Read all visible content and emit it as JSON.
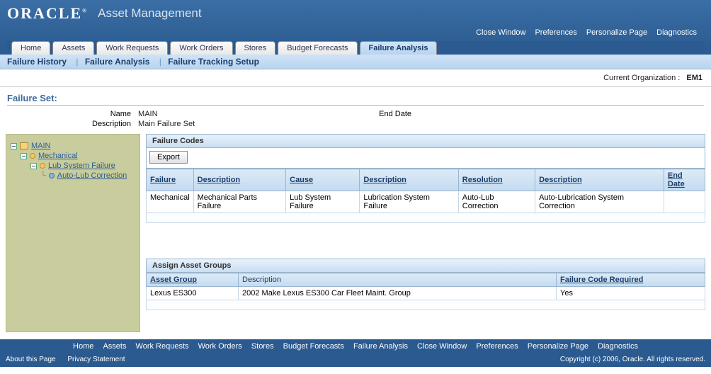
{
  "header": {
    "brand": "ORACLE",
    "app_title": "Asset Management",
    "links": [
      "Close Window",
      "Preferences",
      "Personalize Page",
      "Diagnostics"
    ]
  },
  "tabs": [
    "Home",
    "Assets",
    "Work Requests",
    "Work Orders",
    "Stores",
    "Budget Forecasts",
    "Failure Analysis"
  ],
  "active_tab": "Failure Analysis",
  "subtabs": {
    "items": [
      "Failure History",
      "Failure Analysis",
      "Failure Tracking Setup"
    ],
    "active": "Failure Tracking Setup"
  },
  "org": {
    "label": "Current Organization :",
    "value": "EM1"
  },
  "section_title": "Failure Set:",
  "form": {
    "name_label": "Name",
    "name_value": "MAIN",
    "desc_label": "Description",
    "desc_value": "Main Failure Set",
    "end_date_label": "End Date",
    "end_date_value": ""
  },
  "tree": {
    "root": "MAIN",
    "n1": "Mechanical",
    "n2": "Lub System Failure",
    "n3": "Auto-Lub Correction"
  },
  "failure_codes": {
    "panel_title": "Failure Codes",
    "export_label": "Export",
    "headers": [
      "Failure",
      "Description",
      "Cause",
      "Description",
      "Resolution",
      "Description",
      "End Date"
    ],
    "rows": [
      {
        "failure": "Mechanical",
        "fdesc": "Mechanical Parts Failure",
        "cause": "Lub System Failure",
        "cdesc": "Lubrication System Failure",
        "resolution": "Auto-Lub Correction",
        "rdesc": "Auto-Lubrication System Correction",
        "end": ""
      }
    ]
  },
  "asset_groups": {
    "panel_title": "Assign Asset Groups",
    "headers": [
      "Asset Group",
      "Description",
      "Failure Code Required"
    ],
    "rows": [
      {
        "group": "Lexus ES300",
        "desc": "2002 Make Lexus ES300 Car Fleet Maint. Group",
        "req": "Yes"
      }
    ]
  },
  "footer": {
    "links": [
      "Home",
      "Assets",
      "Work Requests",
      "Work Orders",
      "Stores",
      "Budget Forecasts",
      "Failure Analysis",
      "Close Window",
      "Preferences",
      "Personalize Page",
      "Diagnostics"
    ],
    "about": "About this Page",
    "privacy": "Privacy Statement",
    "copyright": "Copyright (c) 2006, Oracle. All rights reserved."
  }
}
